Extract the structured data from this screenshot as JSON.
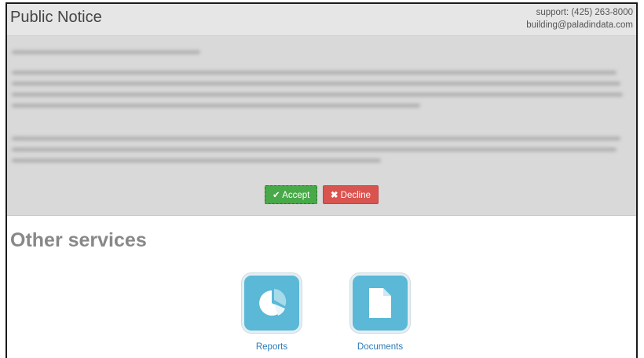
{
  "header": {
    "title": "Public Notice",
    "support_phone": "support: (425) 263-8000",
    "support_email": "building@paladindata.com"
  },
  "notice": {
    "accept_label": "Accept",
    "decline_label": "Decline",
    "accept_color": "#48a948",
    "decline_color": "#d9534f"
  },
  "services": {
    "title": "Other services",
    "items": [
      {
        "label": "Reports",
        "icon": "pie-chart-icon"
      },
      {
        "label": "Documents",
        "icon": "document-icon"
      }
    ]
  }
}
